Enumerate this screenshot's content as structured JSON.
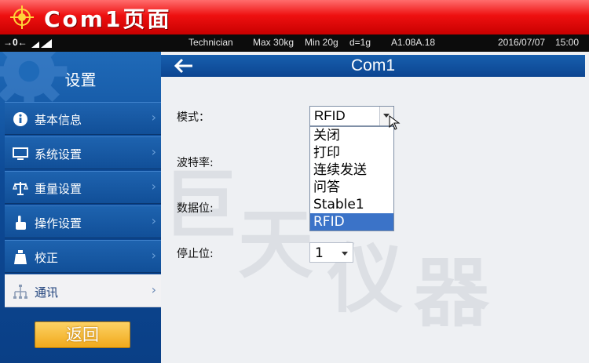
{
  "banner": {
    "title": "Com1页面"
  },
  "status": {
    "zero_indicator": "→0←",
    "role": "Technician",
    "max": "Max 30kg",
    "min": "Min 20g",
    "division": "d=1g",
    "version": "A1.08A.18",
    "date": "2016/07/07",
    "time": "15:00"
  },
  "sidebar": {
    "title": "设置",
    "items": [
      {
        "label": "基本信息",
        "icon": "info-icon"
      },
      {
        "label": "系统设置",
        "icon": "monitor-icon"
      },
      {
        "label": "重量设置",
        "icon": "balance-scale-icon"
      },
      {
        "label": "操作设置",
        "icon": "hand-pointer-icon"
      },
      {
        "label": "校正",
        "icon": "calibration-weight-icon"
      },
      {
        "label": "通讯",
        "icon": "network-icon",
        "active": true
      }
    ],
    "back_label": "返回"
  },
  "main": {
    "title": "Com1",
    "mode_label": "模式：",
    "baud_label": "波特率:",
    "databits_label": "数据位:",
    "stopbits_label": "停止位:",
    "mode_value": "RFID",
    "mode_options": [
      "关闭",
      "打印",
      "连续发送",
      "问答",
      "Stable1",
      "RFID"
    ],
    "mode_selected_index": 5,
    "stopbits_value": "1"
  },
  "watermark": [
    "巨",
    "天",
    "仪",
    "器"
  ],
  "colors": {
    "banner_red": "#ee1010",
    "sidebar_blue": "#0d4a96",
    "header_blue": "#175fae",
    "selected_blue": "#3b73c8",
    "back_button_orange": "#f1a91b"
  }
}
